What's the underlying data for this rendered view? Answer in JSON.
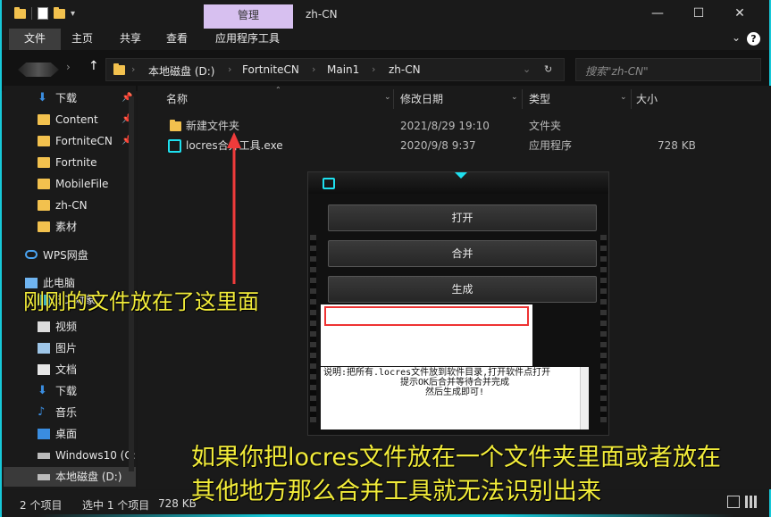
{
  "titlebar": {
    "manage_tab": "管理",
    "title": "zh-CN",
    "minimize": "—",
    "maximize": "☐",
    "close": "✕"
  },
  "ribbon": {
    "tabs": [
      "文件",
      "主页",
      "共享",
      "查看",
      "应用程序工具"
    ],
    "help": "?"
  },
  "address": {
    "crumbs": [
      "本地磁盘 (D:)",
      "FortniteCN",
      "Main1",
      "zh-CN"
    ]
  },
  "search": {
    "placeholder": "搜索\"zh-CN\""
  },
  "sidebar": {
    "items": [
      {
        "label": "下载",
        "icon": "download-icon",
        "pinned": true
      },
      {
        "label": "Content",
        "icon": "folder-icon",
        "pinned": true
      },
      {
        "label": "FortniteCN",
        "icon": "folder-icon",
        "pinned": true
      },
      {
        "label": "Fortnite",
        "icon": "folder-icon",
        "pinned": false
      },
      {
        "label": "MobileFile",
        "icon": "folder-icon",
        "pinned": false
      },
      {
        "label": "zh-CN",
        "icon": "folder-icon",
        "pinned": false
      },
      {
        "label": "素材",
        "icon": "folder-icon",
        "pinned": false
      },
      {
        "label": "WPS网盘",
        "icon": "cloud-icon",
        "pinned": false
      },
      {
        "label": "此电脑",
        "icon": "computer-icon",
        "pinned": false
      },
      {
        "label": "3D 对象",
        "icon": "3d-objects-icon",
        "pinned": false
      },
      {
        "label": "视频",
        "icon": "video-icon",
        "pinned": false
      },
      {
        "label": "图片",
        "icon": "pictures-icon",
        "pinned": false
      },
      {
        "label": "文档",
        "icon": "documents-icon",
        "pinned": false
      },
      {
        "label": "下载",
        "icon": "download-icon",
        "pinned": false
      },
      {
        "label": "音乐",
        "icon": "music-icon",
        "pinned": false
      },
      {
        "label": "桌面",
        "icon": "desktop-icon",
        "pinned": false
      },
      {
        "label": "Windows10 (C:",
        "icon": "drive-icon",
        "pinned": false
      },
      {
        "label": "本地磁盘 (D:)",
        "icon": "drive-icon",
        "pinned": false
      }
    ]
  },
  "columns": {
    "name": "名称",
    "modified": "修改日期",
    "type": "类型",
    "size": "大小"
  },
  "files": [
    {
      "name": "新建文件夹",
      "modified": "2021/8/29 19:10",
      "type": "文件夹",
      "size": "",
      "icon": "folder-icon"
    },
    {
      "name": "locres合并工具.exe",
      "modified": "2020/9/8 9:37",
      "type": "应用程序",
      "size": "728 KB",
      "icon": "exe-icon"
    }
  ],
  "status": {
    "count": "2 个项目",
    "selected": "选中 1 个项目",
    "size": "728 KB"
  },
  "tool": {
    "buttons": [
      "打开",
      "合并",
      "生成"
    ],
    "desc_lines": [
      "说明:把所有.locres文件放到软件目录,打开软件点打开",
      "提示OK后合并等待合并完成",
      "然后生成即可!"
    ]
  },
  "annotations": {
    "top": "刚刚的文件放在了这里面",
    "bottom_line1": "如果你把locres文件放在一个文件夹里面或者放在",
    "bottom_line2": "其他地方那么合并工具就无法识别出来"
  },
  "colors": {
    "accent": "#16c8d8",
    "annotation": "#f2ec3a",
    "manage_tab": "#d7c0f0",
    "folder": "#f2c14e"
  }
}
